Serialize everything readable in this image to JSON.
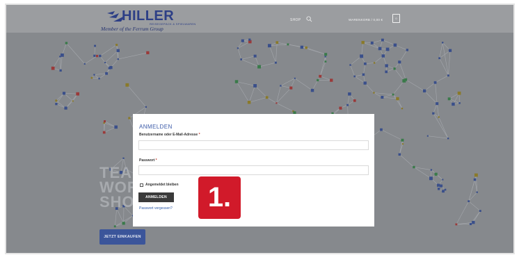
{
  "header": {
    "logo": {
      "brand": "HILLER",
      "tagline": "REISEGEPÄCK & SPIELWAREN",
      "member": "Member of the Ferrum Group"
    },
    "nav": {
      "shop_label": "SHOP",
      "cart_label": "WARENKORB / 0,00 €",
      "cart_count": "0"
    }
  },
  "hero": {
    "text_lines": [
      "TEA",
      "WOR",
      "SHO"
    ],
    "button_label": "JETZT EINKAUFEN"
  },
  "login_modal": {
    "title": "ANMELDEN",
    "username_label": "Benutzername oder E-Mail-Adresse",
    "username_value": "",
    "password_label": "Passwort",
    "password_value": "",
    "required_mark": "*",
    "remember_label": "Angemeldet bleiben",
    "remember_checked": false,
    "submit_label": "ANMELDEN",
    "forgot_label": "Passwort vergessen?"
  },
  "annotation": {
    "step_label": "1."
  },
  "colors": {
    "accent_blue": "#3b5aa8",
    "badge_red": "#d11a2a",
    "button_dark": "#3a3a3a"
  }
}
